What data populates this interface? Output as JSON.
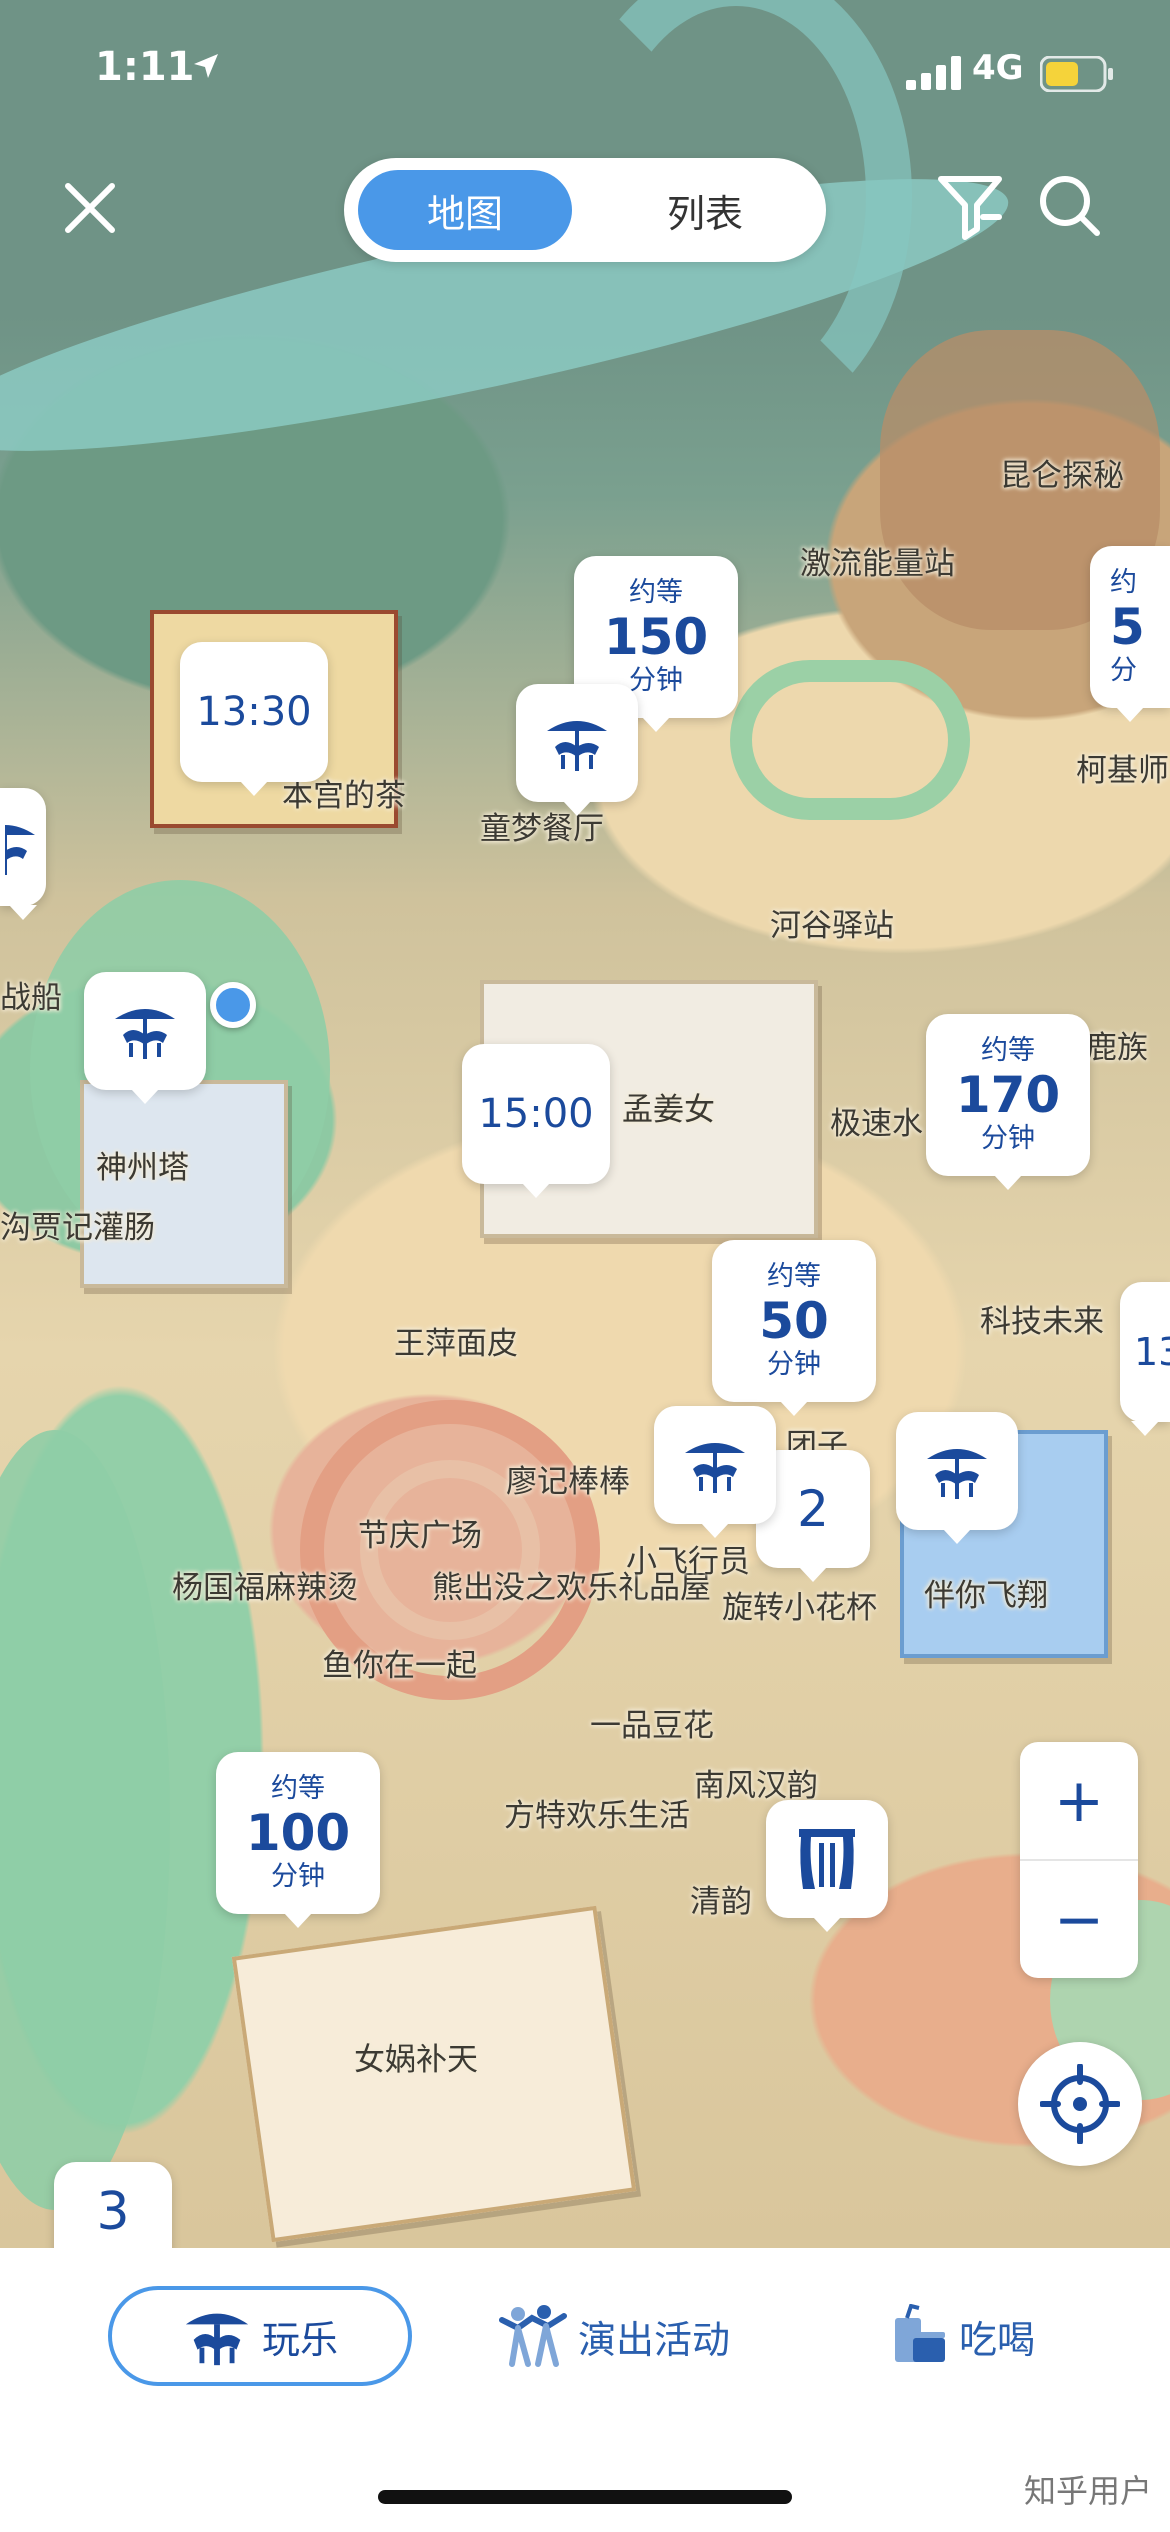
{
  "status_bar": {
    "time": "1:11",
    "network": "4G"
  },
  "header": {
    "tabs": [
      {
        "label": "地图",
        "active": true
      },
      {
        "label": "列表",
        "active": false
      }
    ],
    "close_icon": "close-icon",
    "filter_icon": "filter-icon",
    "search_icon": "search-icon"
  },
  "map": {
    "places": {
      "kunlun": "昆仑探秘",
      "jiliu": "激流能量站",
      "kejiju": "柯基师",
      "tongmeng": "童梦餐厅",
      "bengong": "本宫的茶",
      "hegu": "河谷驿站",
      "zhanchuan": "战船",
      "shenzhouta": "神州塔",
      "guanchang": "沟贾记灌肠",
      "mengjiangnv": "孟姜女",
      "jisu": "极速水",
      "luzu": "鹿族",
      "kejiweilai": "科技未来",
      "wangping": "王萍面皮",
      "liaoji": "廖记棒棒",
      "tuanzi": "团子",
      "jieqing": "节庆广场",
      "yangguofu": "杨国福麻辣烫",
      "xiongchumo": "熊出没之欢乐礼品屋",
      "xiaofeixing": "小飞行员",
      "xuanzhuan": "旋转小花杯",
      "bannifeixiang": "伴你飞翔",
      "yuni": "鱼你在一起",
      "yipindou": "一品豆花",
      "nanfeng": "南风汉韵",
      "fangte": "方特欢乐生活",
      "qingyun": "清韵",
      "nvwa": "女娲补天"
    },
    "markers": {
      "wait_150": {
        "top": "约等",
        "num": "150",
        "bot": "分钟"
      },
      "wait_170": {
        "top": "约等",
        "num": "170",
        "bot": "分钟"
      },
      "wait_50": {
        "top": "约等",
        "num": "50",
        "bot": "分钟"
      },
      "wait_100": {
        "top": "约等",
        "num": "100",
        "bot": "分钟"
      },
      "wait_edge": {
        "top": "约",
        "num": "5",
        "bot": "分"
      },
      "show_1330": "13:30",
      "show_1500": "15:00",
      "cluster_2": "2",
      "cluster_3": "3",
      "edge_13": "13"
    },
    "zoom_in": "+",
    "zoom_out": "−"
  },
  "bottom_nav": {
    "tabs": [
      {
        "label": "玩乐",
        "active": true,
        "icon": "carousel-icon"
      },
      {
        "label": "演出活动",
        "active": false,
        "icon": "performers-icon"
      },
      {
        "label": "吃喝",
        "active": false,
        "icon": "food-icon"
      }
    ]
  },
  "watermark": "知乎用户",
  "colors": {
    "accent": "#4a98e8",
    "marker_text": "#1b4a9c"
  }
}
